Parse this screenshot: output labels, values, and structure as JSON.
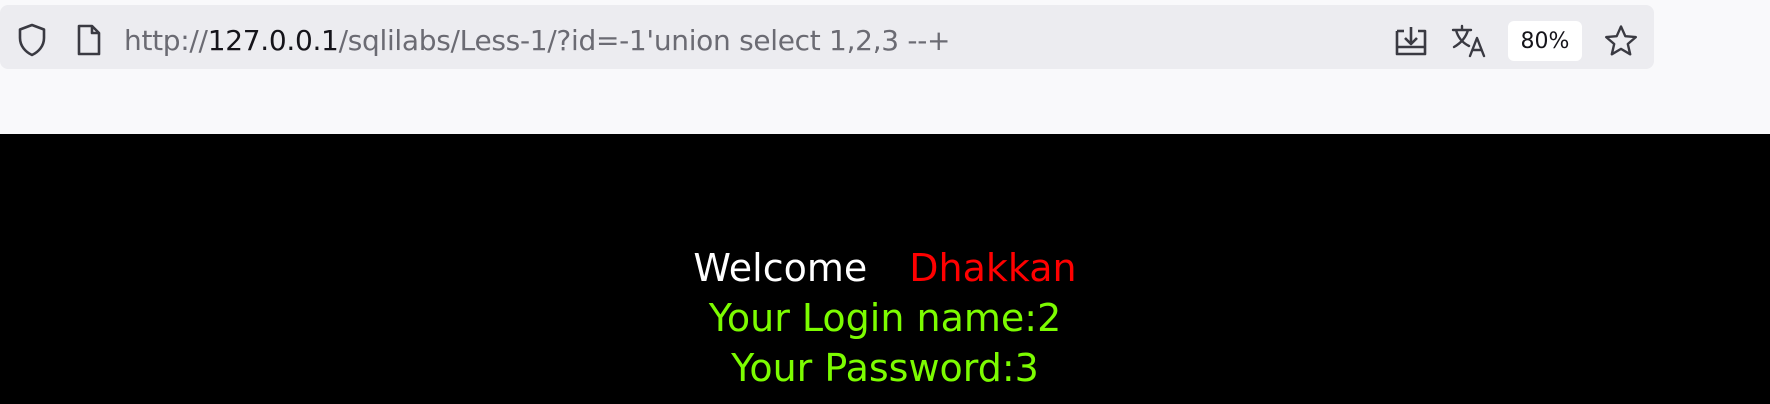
{
  "browser": {
    "url": {
      "scheme": "http://",
      "host": "127.0.0.1",
      "path": "/sqlilabs/Less-1/?id=-1'union select 1,2,3 --+"
    },
    "zoom_label": "80%",
    "icons": {
      "shield": "shield-icon",
      "page": "page-icon",
      "download": "download-icon",
      "translate": "translate-icon",
      "star": "star-icon"
    }
  },
  "page": {
    "welcome_label": "Welcome",
    "welcome_name": "Dhakkan",
    "login_line": "Your Login name:2",
    "password_line": "Your Password:3",
    "colors": {
      "background": "#000000",
      "welcome": "#ffffff",
      "name": "#ff0000",
      "info": "#7cfc00"
    }
  }
}
